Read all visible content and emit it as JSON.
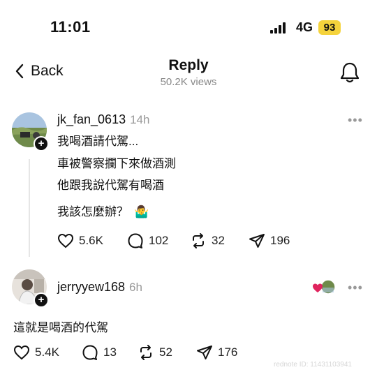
{
  "status_bar": {
    "time": "11:01",
    "network": "4G",
    "battery": "93",
    "battery_color": "#f5d33c"
  },
  "header": {
    "back_label": "Back",
    "title": "Reply",
    "views": "50.2K views"
  },
  "post": {
    "username": "jk_fan_0613",
    "time_ago": "14h",
    "more": "•••",
    "lines": [
      "我喝酒請代駕...",
      "車被警察攔下來做酒測",
      "他跟我說代駕有喝酒"
    ],
    "question": "我該怎麼辦？",
    "emoji": "🤷‍♂️",
    "likes": "5.6K",
    "comments": "102",
    "reposts": "32",
    "shares": "196"
  },
  "reply": {
    "username": "jerryyew168",
    "time_ago": "6h",
    "more": "•••",
    "text": "這就是喝酒的代駕",
    "likes": "5.4K",
    "comments": "13",
    "reposts": "52",
    "shares": "176"
  },
  "watermark": "rednote ID: 11431103941"
}
